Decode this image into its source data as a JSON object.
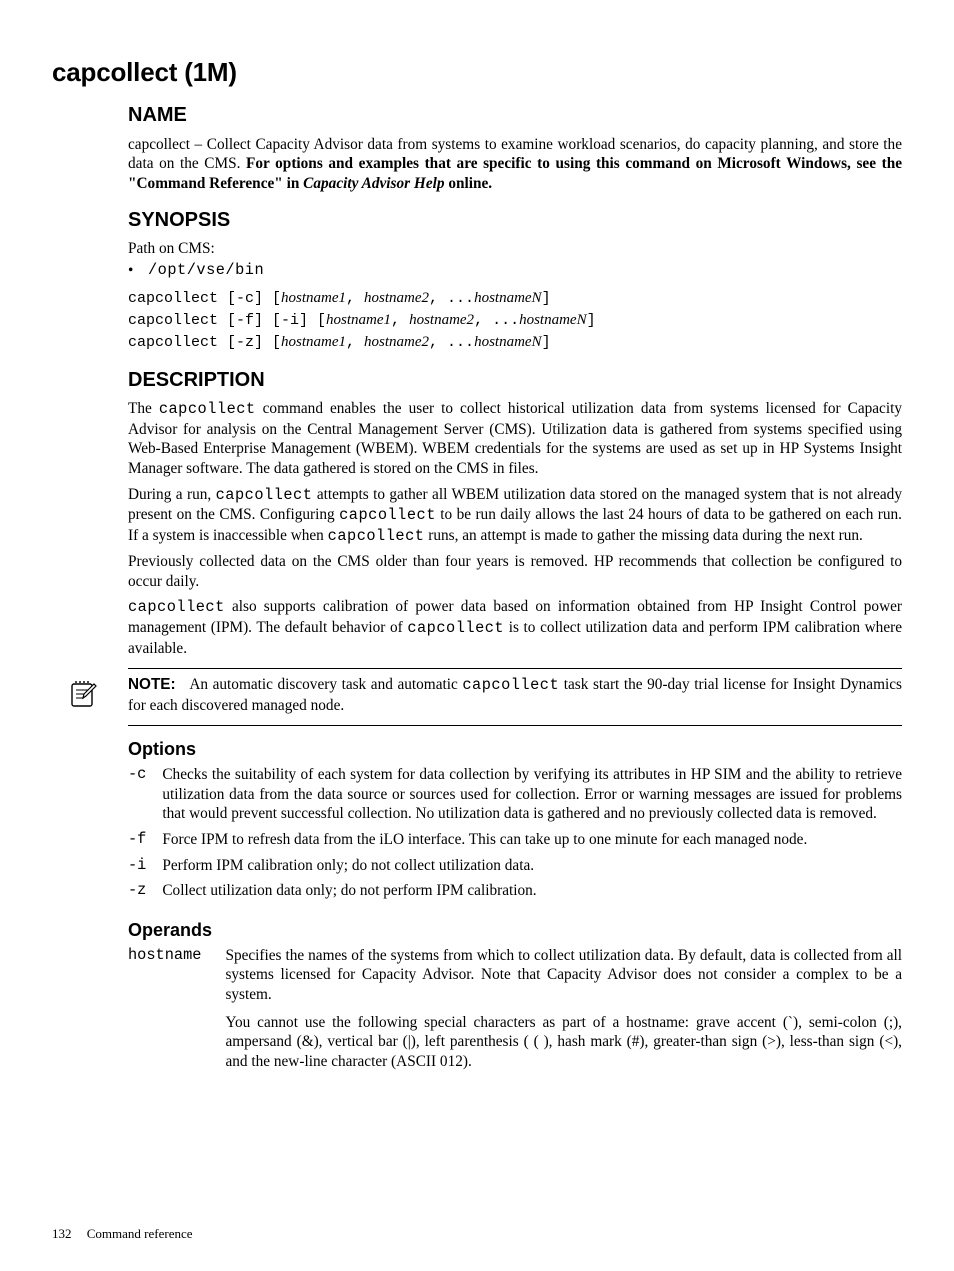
{
  "title": "capcollect (1M)",
  "name": {
    "heading": "NAME",
    "text_before": "capcollect – Collect Capacity Advisor data from systems to examine workload scenarios, do capacity planning, and store the data on the CMS. ",
    "text_bold": "For options and examples that are specific to using this command on Microsoft Windows, see the \"Command Reference\" in ",
    "text_italic": "Capacity Advisor Help",
    "text_after": " online."
  },
  "synopsis": {
    "heading": "SYNOPSIS",
    "path_label": "Path on CMS:",
    "path_value": "/opt/vse/bin",
    "lines": [
      {
        "cmd": "capcollect [-c] [",
        "arg1": "hostname1",
        "sep1": ", ",
        "arg2": "hostname2",
        "sep2": ", ...",
        "argn": "hostnameN",
        "close": "]"
      },
      {
        "cmd": "capcollect [-f] [-i] [",
        "arg1": "hostname1",
        "sep1": ", ",
        "arg2": "hostname2",
        "sep2": ", ...",
        "argn": "hostnameN",
        "close": "]"
      },
      {
        "cmd": "capcollect [-z] [",
        "arg1": "hostname1",
        "sep1": ", ",
        "arg2": "hostname2",
        "sep2": ", ...",
        "argn": "hostnameN",
        "close": "]"
      }
    ]
  },
  "description": {
    "heading": "DESCRIPTION",
    "p1a": "The ",
    "p1b": "capcollect",
    "p1c": " command enables the user to collect historical utilization data from systems licensed for Capacity Advisor for analysis on the Central Management Server (CMS). Utilization data is gathered from systems specified using Web-Based Enterprise Management (WBEM). WBEM credentials for the systems are used as set up in HP Systems Insight Manager software. The data gathered is stored on the CMS in files.",
    "p2a": "During a run, ",
    "p2b": "capcollect",
    "p2c": " attempts to gather all WBEM utilization data stored on the managed system that is not already present on the CMS. Configuring ",
    "p2d": "capcollect",
    "p2e": " to be run daily allows the last 24 hours of data to be gathered on each run. If a system is inaccessible when ",
    "p2f": "capcollect",
    "p2g": " runs, an attempt is made to gather the missing data during the next run.",
    "p3": "Previously collected data on the CMS older than four years is removed. HP recommends that collection be configured to occur daily.",
    "p4a": "capcollect",
    "p4b": " also supports calibration of power data based on information obtained from HP Insight Control power management (IPM). The default behavior of ",
    "p4c": "capcollect",
    "p4d": " is to collect utilization data and perform IPM calibration where available."
  },
  "note": {
    "label": "NOTE:",
    "t1": "An automatic discovery task and automatic ",
    "t2": "capcollect",
    "t3": " task start the 90-day trial license for Insight Dynamics for each discovered managed node."
  },
  "options": {
    "heading": "Options",
    "items": [
      {
        "flag": "-c",
        "desc": "Checks the suitability of each system for data collection by verifying its attributes in HP SIM and the ability to retrieve utilization data from the data source or sources used for collection. Error or warning messages are issued for problems that would prevent successful collection. No utilization data is gathered and no previously collected data is removed."
      },
      {
        "flag": "-f",
        "desc": "Force IPM to refresh data from the iLO interface. This can take up to one minute for each managed node."
      },
      {
        "flag": "-i",
        "desc": "Perform IPM calibration only; do not collect utilization data."
      },
      {
        "flag": "-z",
        "desc": "Collect utilization data only; do not perform IPM calibration."
      }
    ]
  },
  "operands": {
    "heading": "Operands",
    "key": "hostname",
    "p1": "Specifies the names of the systems from which to collect utilization data. By default, data is collected from all systems licensed for Capacity Advisor. Note that Capacity Advisor does not consider a complex to be a system.",
    "p2": "You cannot use the following special characters as part of a hostname: grave accent (`), semi-colon (;), ampersand (&), vertical bar (|), left parenthesis ( ( ), hash mark (#), greater-than sign (>), less-than sign (<), and the new-line character (ASCII 012)."
  },
  "footer": {
    "page_number": "132",
    "section": "Command reference"
  }
}
